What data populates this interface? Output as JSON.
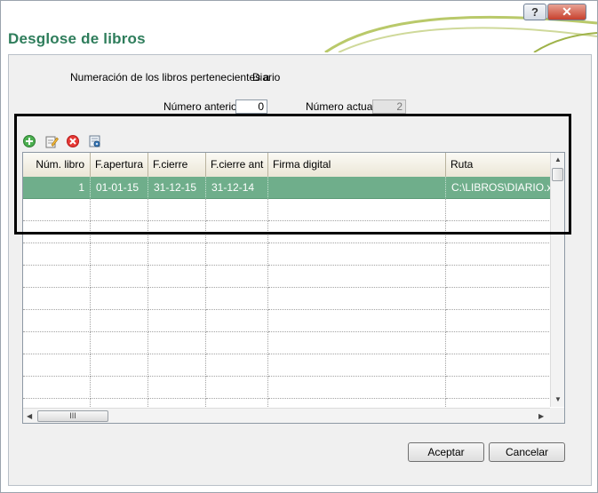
{
  "window": {
    "title": "Desglose de libros",
    "help_button": "?",
    "close_button": "✕"
  },
  "form": {
    "description_label": "Numeración de los libros pertenecientes a",
    "book_name": "Diario",
    "previous_number_label": "Número anterior",
    "previous_number_value": "0",
    "current_number_label": "Número actual",
    "current_number_value": "2"
  },
  "toolbar": {
    "icons": [
      "add-icon",
      "edit-icon",
      "delete-icon",
      "view-icon"
    ]
  },
  "grid": {
    "columns": [
      "Núm. libro",
      "F.apertura",
      "F.cierre",
      "F.cierre ant",
      "Firma digital",
      "Ruta"
    ],
    "rows": [
      [
        "1",
        "01-01-15",
        "31-12-15",
        "31-12-14",
        "",
        "C:\\LIBROS\\DIARIO.xls"
      ]
    ],
    "hscroll_grip": "III"
  },
  "buttons": {
    "accept": "Aceptar",
    "cancel": "Cancelar"
  },
  "colors": {
    "title": "#2e7d5b",
    "selected_row": "#6fae8b",
    "highlight_border": "#000000"
  }
}
